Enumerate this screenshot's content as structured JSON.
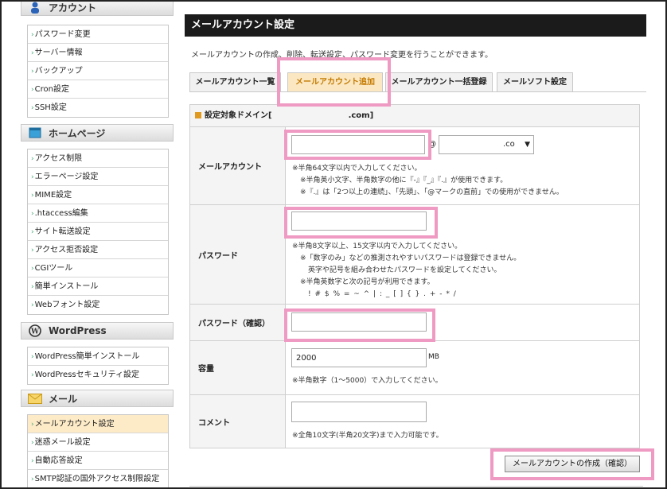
{
  "sidebar": {
    "account": {
      "title": "アカウント",
      "items": [
        "パスワード変更",
        "サーバー情報",
        "バックアップ",
        "Cron設定",
        "SSH設定"
      ]
    },
    "homepage": {
      "title": "ホームページ",
      "items": [
        "アクセス制限",
        "エラーページ設定",
        "MIME設定",
        ".htaccess編集",
        "サイト転送設定",
        "アクセス拒否設定",
        "CGIツール",
        "簡単インストール",
        "Webフォント設定"
      ]
    },
    "wordpress": {
      "title": "WordPress",
      "items": [
        "WordPress簡単インストール",
        "WordPressセキュリティ設定"
      ]
    },
    "mail": {
      "title": "メール",
      "items": [
        "メールアカウント設定",
        "迷惑メール設定",
        "自動応答設定",
        "SMTP認証の国外アクセス制限設定"
      ],
      "active_index": 0
    }
  },
  "main": {
    "title": "メールアカウント設定",
    "description": "メールアカウントの作成、削除、転送設定、パスワード変更を行うことができます。",
    "tabs": [
      "メールアカウント一覧",
      "メールアカウント追加",
      "メールアカウント一括登録",
      "メールソフト設定"
    ],
    "active_tab": 1,
    "domain_label": "設定対象ドメイン[",
    "domain_suffix": ".com]",
    "form": {
      "account": {
        "label": "メールアカウント",
        "at": "@",
        "domain_select": ".co",
        "notes": [
          "※半角64文字以内で入力してください。",
          "※半角英小文字、半角数字の他に『-』『_』『.』が使用できます。",
          "※『.』は「2つ以上の連続」、「先頭」、「@マークの直前」での使用ができません。"
        ]
      },
      "password": {
        "label": "パスワード",
        "notes": [
          "※半角8文字以上、15文字以内で入力してください。",
          "※「数字のみ」などの推測されやすいパスワードは登録できません。",
          "英字や記号を組み合わせたパスワードを設定してください。",
          "※半角英数字と次の記号が利用できます。",
          "! # $ % = ~ ^ | : _ [ ] { } . + - * /"
        ]
      },
      "password_confirm": {
        "label": "パスワード（確認）"
      },
      "capacity": {
        "label": "容量",
        "value": "2000",
        "unit": "MB",
        "note": "※半角数字（1～5000）で入力してください。"
      },
      "comment": {
        "label": "コメント",
        "note": "※全角10文字(半角20文字)まで入力可能です。"
      }
    },
    "submit_label": "メールアカウントの作成（確認）"
  },
  "colors": {
    "highlight": "#ef9ac3",
    "active_tab_bg": "#fbe8c3",
    "active_tab_text": "#c47a00",
    "title_bar": "#1b1b1b"
  }
}
